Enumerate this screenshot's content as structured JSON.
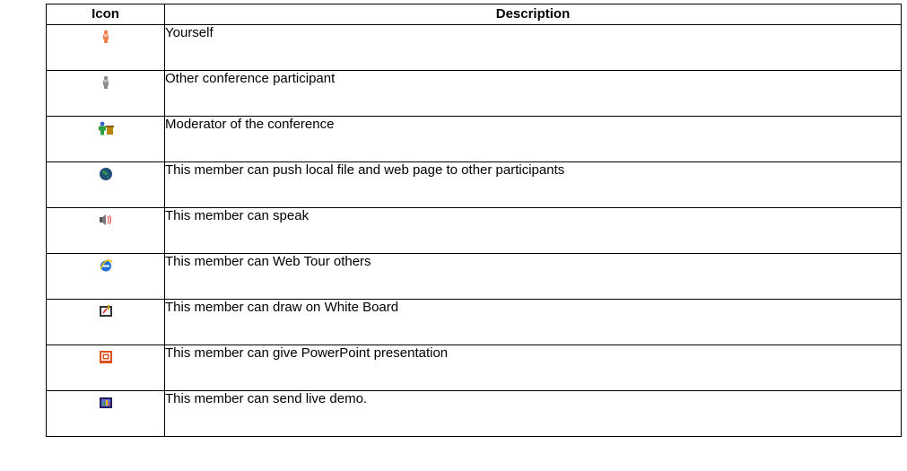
{
  "table": {
    "headers": {
      "icon": "Icon",
      "description": "Description"
    },
    "rows": [
      {
        "icon": "person-orange-icon",
        "description": "Yourself"
      },
      {
        "icon": "person-gray-icon",
        "description": "Other conference participant"
      },
      {
        "icon": "moderator-icon",
        "description": "Moderator of the conference"
      },
      {
        "icon": "globe-icon",
        "description": "This member can push local file and web page to other participants"
      },
      {
        "icon": "speaker-icon",
        "description": "This member can speak"
      },
      {
        "icon": "internet-explorer-icon",
        "description": "This member can Web Tour others"
      },
      {
        "icon": "whiteboard-icon",
        "description": "This member can draw on White Board"
      },
      {
        "icon": "powerpoint-icon",
        "description": "This member can give PowerPoint presentation"
      },
      {
        "icon": "live-demo-icon",
        "description": "This member can send live demo."
      }
    ]
  },
  "colors": {
    "border": "#000000",
    "self_icon": "#f08050",
    "other_icon": "#8c8c8c"
  }
}
